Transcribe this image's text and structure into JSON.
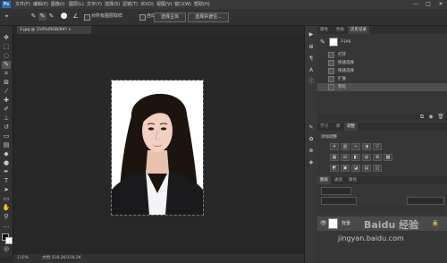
{
  "menubar": {
    "logo": "Ps",
    "items": [
      "文件(F)",
      "编辑(E)",
      "图像(I)",
      "图层(L)",
      "文字(Y)",
      "选择(S)",
      "滤镜(T)",
      "3D(D)",
      "视图(V)",
      "窗口(W)",
      "帮助(H)"
    ],
    "win_min": "—",
    "win_max": "□",
    "win_close": "✕"
  },
  "options": {
    "check_all_layers": "对所有图层取样",
    "check_auto_enhance": "自动增强",
    "select_subject": "选择主体",
    "select_and_mask": "选择并遮住..."
  },
  "document": {
    "tab_title": "2.jpg @ 110%(RGB/8#) ×",
    "zoom": "110%",
    "doc_info": "文档:318.2K/318.2K"
  },
  "panels": {
    "top_tabs": [
      "属性",
      "色板",
      "历史记录"
    ],
    "history_snapshot": "2.jpg",
    "history_items": [
      "打开",
      "快速选择",
      "快速选择",
      "扩展",
      "羽化"
    ],
    "mid_tabs": [
      "学习",
      "库",
      "调整"
    ],
    "adjust_label": "添加调整",
    "layers_tabs": [
      "图层",
      "通道",
      "路径"
    ],
    "layer_name": "背景"
  },
  "watermark": {
    "site": "jingyan.baidu.com",
    "brand": "Baidu 经验"
  }
}
